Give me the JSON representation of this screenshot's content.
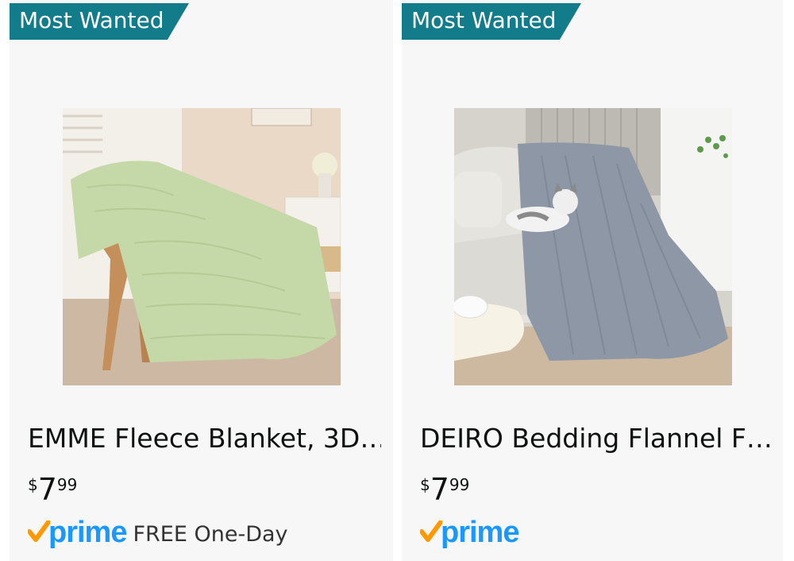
{
  "products": [
    {
      "badge": "Most Wanted",
      "title": "EMME Fleece Blanket, 3D…",
      "price": {
        "currency": "$",
        "whole": "7",
        "fraction": "99"
      },
      "prime": "prime",
      "shipping": "FREE One-Day",
      "image": "green fleece blanket draped over wooden chair",
      "blanket_color": "#c5d9a8"
    },
    {
      "badge": "Most Wanted",
      "title": "DEIRO Bedding Flannel F…",
      "price": {
        "currency": "$",
        "whole": "7",
        "fraction": "99"
      },
      "prime": "prime",
      "shipping": "",
      "image": "grey flannel blanket on sofa with cat",
      "blanket_color": "#8d97a6"
    }
  ],
  "colors": {
    "badge": "#127c8a",
    "prime_blue": "#1a98ff",
    "prime_check": "#ff9900",
    "card_bg": "#f7f7f7"
  }
}
